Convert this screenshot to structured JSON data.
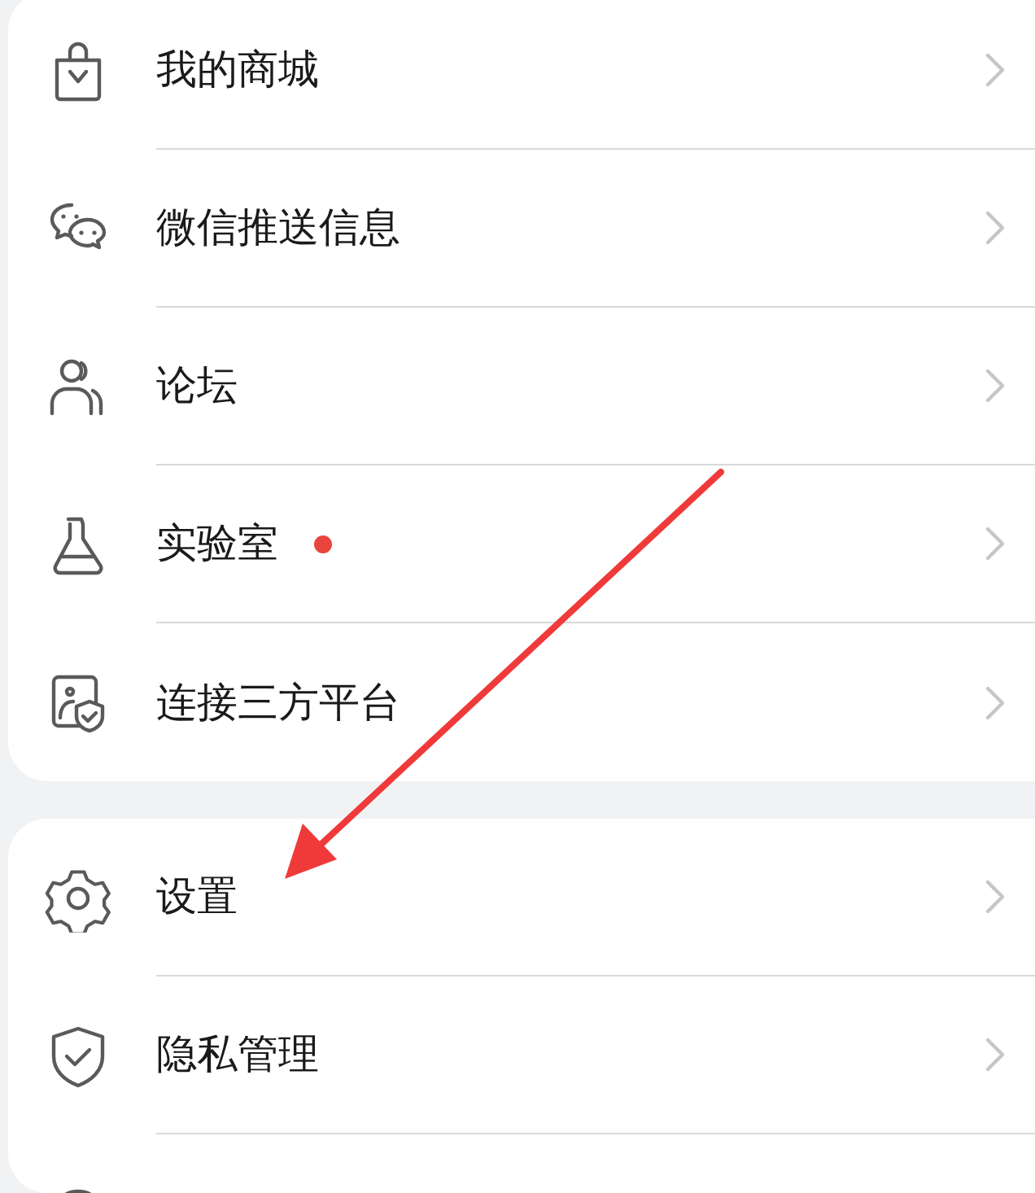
{
  "groups": [
    {
      "items": [
        {
          "label": "我的商城",
          "badge_dot": false
        },
        {
          "label": "微信推送信息",
          "badge_dot": false
        },
        {
          "label": "论坛",
          "badge_dot": false
        },
        {
          "label": "实验室",
          "badge_dot": true
        },
        {
          "label": "连接三方平台",
          "badge_dot": false
        }
      ]
    },
    {
      "items": [
        {
          "label": "设置",
          "badge_dot": false
        },
        {
          "label": "隐私管理",
          "badge_dot": false
        },
        {
          "kind": "partial"
        }
      ]
    }
  ],
  "annotation": {
    "kind": "arrow"
  }
}
